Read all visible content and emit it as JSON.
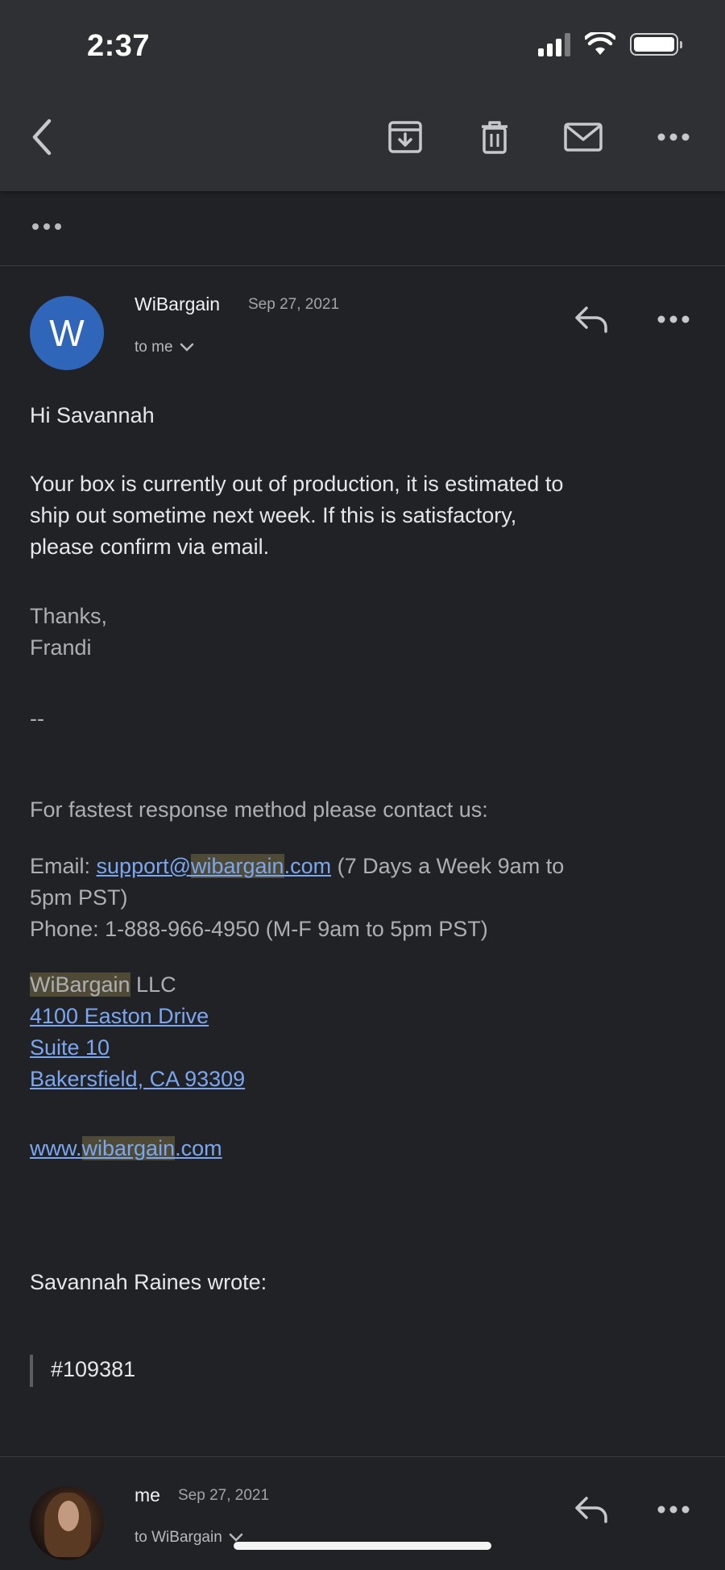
{
  "status_bar": {
    "time": "2:37"
  },
  "toolbar": {
    "back": "back-icon",
    "archive": "archive-icon",
    "delete": "trash-icon",
    "mark_unread": "mail-icon",
    "more": "more-icon"
  },
  "message": {
    "sender": "WiBargain",
    "date": "Sep 27, 2021",
    "to": "to me",
    "avatar_letter": "W",
    "avatar_color": "#2f66b9",
    "greeting": "Hi Savannah",
    "paragraph": [
      "Your box is currently out of production, it is estimated to",
      "ship out sometime next week. If this is satisfactory,",
      "please confirm via email."
    ],
    "thanks": "Thanks,",
    "signer": "Frandi",
    "separator": "--",
    "contact_intro": "For fastest response method please contact us:",
    "email_label": "Email: ",
    "email_pre": "support@",
    "email_hl": "wibargain",
    "email_post": ".com",
    "email_hours": " (7 Days a Week 9am to",
    "email_hours_2": "5pm PST)",
    "phone": "Phone: 1-888-966-4950 (M-F 9am to 5pm PST)",
    "company_hl": "WiBargain",
    "company_rest": " LLC",
    "address_1": "4100 Easton Drive",
    "address_2": "Suite 10",
    "address_3": "Bakersfield, CA 93309",
    "site_pre": "www.",
    "site_hl": "wibargain",
    "site_post": ".com",
    "quote_header": "Savannah Raines wrote:",
    "quote_text": "#109381"
  },
  "reply": {
    "sender": "me",
    "date": "Sep 27, 2021",
    "to": "to WiBargain"
  },
  "colors": {
    "background": "#212226",
    "toolbar": "#2f3033",
    "link": "#7aa7f0",
    "highlight": "#4e4a36"
  }
}
